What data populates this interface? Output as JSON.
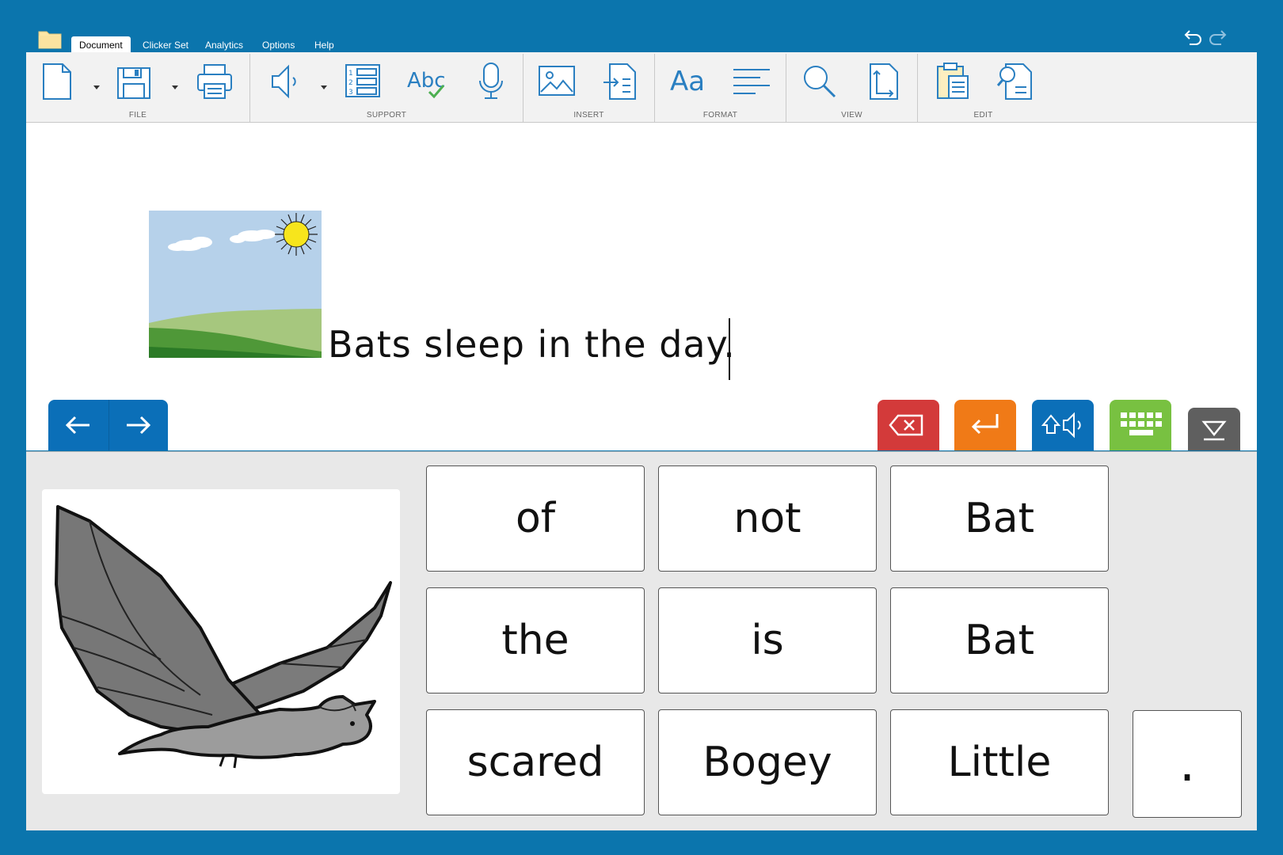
{
  "menu": {
    "tabs": [
      "Document",
      "Clicker Set",
      "Analytics",
      "Options",
      "Help"
    ],
    "active_tab": "Document"
  },
  "ribbon": {
    "groups": [
      "FILE",
      "SUPPORT",
      "INSERT",
      "FORMAT",
      "VIEW",
      "EDIT"
    ],
    "format_label": "Aa",
    "spell_label": "Abc"
  },
  "document": {
    "text": "Bats sleep in the day."
  },
  "grid": {
    "cells": [
      "of",
      "not",
      "Bat",
      "the",
      "is",
      "Bat",
      "scared",
      "Bogey",
      "Little"
    ],
    "punctuation": "."
  },
  "colors": {
    "frame": "#0b75ad",
    "nav": "#0b6fb8",
    "delete": "#d33a3a",
    "enter": "#f07a17",
    "speak": "#0b6fb8",
    "keyboard": "#78c141",
    "hide": "#5f5f5f"
  },
  "icons": {
    "folder": "folder-icon",
    "undo": "undo-icon",
    "redo": "redo-icon",
    "new": "new-document-icon",
    "save": "save-icon",
    "print": "print-icon",
    "speech": "speech-icon",
    "wordlist": "numbered-list-icon",
    "spellcheck": "spellcheck-icon",
    "microphone": "microphone-icon",
    "picture": "insert-picture-icon",
    "insert_file": "insert-file-icon",
    "font": "font-icon",
    "align": "alignment-icon",
    "zoom": "zoom-icon",
    "page_size": "page-size-icon",
    "paste": "paste-icon",
    "find": "find-icon",
    "back": "arrow-left-icon",
    "forward": "arrow-right-icon",
    "delete": "delete-icon",
    "enter": "enter-icon",
    "speak": "speak-icon",
    "keyboard": "keyboard-icon",
    "hide": "hide-grid-icon"
  }
}
